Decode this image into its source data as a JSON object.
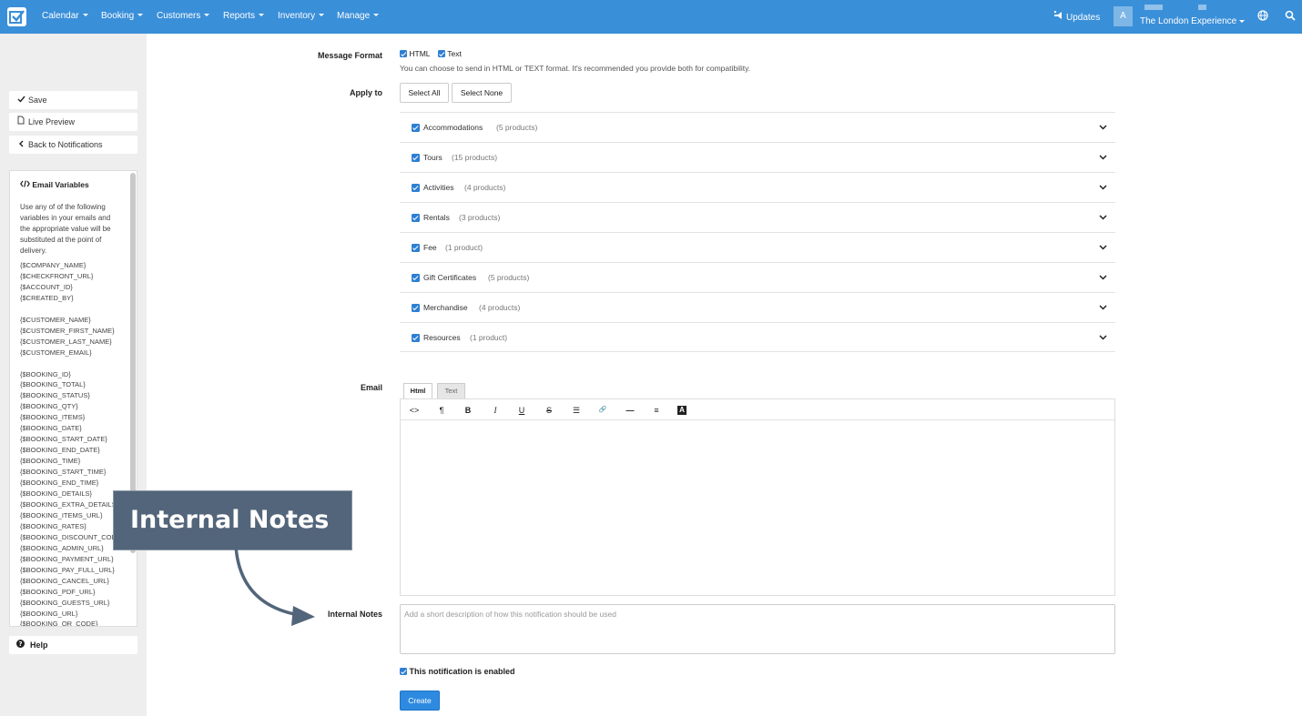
{
  "nav": {
    "items": [
      "Calendar",
      "Booking",
      "Customers",
      "Reports",
      "Inventory",
      "Manage"
    ],
    "updates_label": "Updates",
    "avatar_initial": "A",
    "company_name": "The London Experience"
  },
  "sidebar": {
    "save_label": "Save",
    "preview_label": "Live Preview",
    "back_label": "Back to Notifications",
    "vars_title": "Email Variables",
    "vars_description": "Use any of of the following variables in your emails and the appropriate value will be substituted at the point of delivery.",
    "vars_list": "{$COMPANY_NAME}\n{$CHECKFRONT_URL}\n{$ACCOUNT_ID}\n{$CREATED_BY}\n\n{$CUSTOMER_NAME}\n{$CUSTOMER_FIRST_NAME}\n{$CUSTOMER_LAST_NAME}\n{$CUSTOMER_EMAIL}\n\n{$BOOKING_ID}\n{$BOOKING_TOTAL}\n{$BOOKING_STATUS}\n{$BOOKING_QTY}\n{$BOOKING_ITEMS}\n{$BOOKING_DATE}\n{$BOOKING_START_DATE}\n{$BOOKING_END_DATE}\n{$BOOKING_TIME}\n{$BOOKING_START_TIME}\n{$BOOKING_END_TIME}\n{$BOOKING_DETAILS}\n{$BOOKING_EXTRA_DETAILS}\n{$BOOKING_ITEMS_URL}\n{$BOOKING_RATES}\n{$BOOKING_DISCOUNT_CODES}\n{$BOOKING_ADMIN_URL}\n{$BOOKING_PAYMENT_URL}\n{$BOOKING_PAY_FULL_URL}\n{$BOOKING_CANCEL_URL}\n{$BOOKING_PDF_URL}\n{$BOOKING_GUESTS_URL}\n{$BOOKING_URL}\n{$BOOKING_QR_CODE}",
    "help_label": "Help"
  },
  "form": {
    "message_format_label": "Message Format",
    "format_html": "HTML",
    "format_text": "Text",
    "format_hint": "You can choose to send in HTML or TEXT format. It's recommended you provide both for compatibility.",
    "apply_to_label": "Apply to",
    "select_all": "Select All",
    "select_none": "Select None",
    "products": [
      {
        "name": "Accommodations",
        "count": "(5 products)"
      },
      {
        "name": "Tours",
        "count": "(15 products)"
      },
      {
        "name": "Activities",
        "count": "(4 products)"
      },
      {
        "name": "Rentals",
        "count": "(3 products)"
      },
      {
        "name": "Fee",
        "count": "(1 product)"
      },
      {
        "name": "Gift Certificates",
        "count": "(5 products)"
      },
      {
        "name": "Merchandise",
        "count": "(4 products)"
      },
      {
        "name": "Resources",
        "count": "(1 product)"
      }
    ],
    "email_label": "Email",
    "tab_html": "Html",
    "tab_text": "Text",
    "toolbar": {
      "code": "<>",
      "paragraph": "¶",
      "bold": "B",
      "italic": "I",
      "underline": "U",
      "strike": "S",
      "list": "☰",
      "link": "🔗",
      "hr": "—",
      "align": "≡",
      "font_color": "A"
    },
    "internal_notes_label": "Internal Notes",
    "internal_notes_placeholder": "Add a short description of how this notification should be used",
    "enabled_label": "This notification is enabled",
    "create_label": "Create"
  },
  "callout": {
    "text": "Internal Notes"
  },
  "colors": {
    "topbar": "#3a8fd9",
    "accent": "#2d7fd3",
    "callout": "#53657a"
  }
}
